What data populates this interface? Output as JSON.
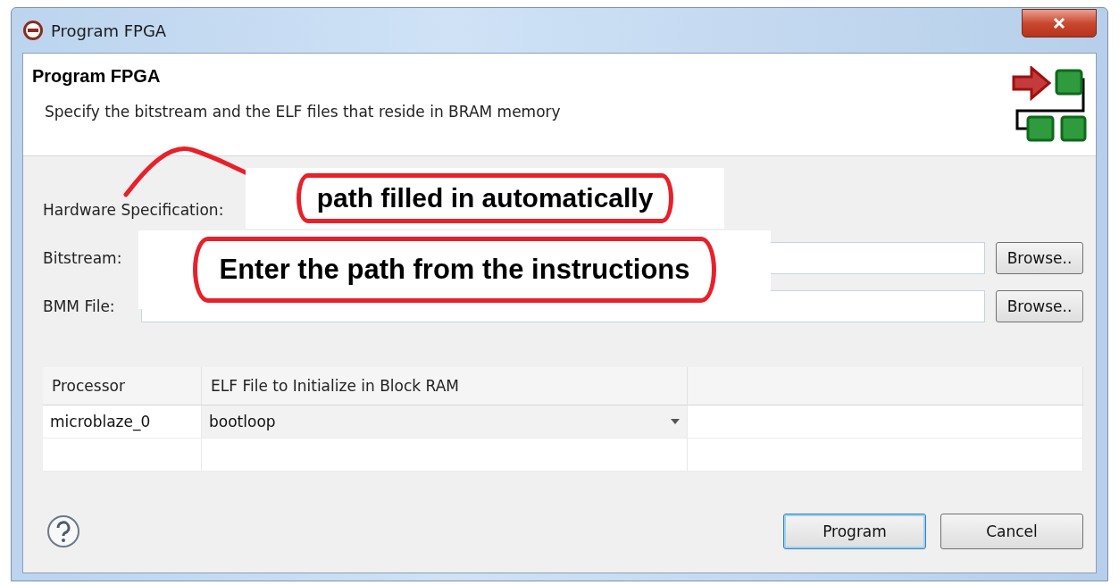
{
  "window": {
    "title": "Program FPGA"
  },
  "header": {
    "title": "Program FPGA",
    "description": "Specify the bitstream and the ELF files that reside in BRAM memory"
  },
  "fields": [
    {
      "label": "Hardware Specification:",
      "kind": "text"
    },
    {
      "label": "Bitstream:",
      "kind": "input",
      "button": "Browse.."
    },
    {
      "label": "BMM File:",
      "kind": "input",
      "button": "Browse.."
    }
  ],
  "table": {
    "columns": [
      "Processor",
      "ELF File to Initialize in Block RAM"
    ],
    "rows": [
      {
        "processor": "microblaze_0",
        "elf": "bootloop"
      }
    ]
  },
  "buttons": [
    {
      "label": "Program",
      "default": true
    },
    {
      "label": "Cancel",
      "default": false
    }
  ],
  "annotations": [
    {
      "text": "path filled in automatically"
    },
    {
      "text": "Enter the path from the instructions"
    }
  ]
}
